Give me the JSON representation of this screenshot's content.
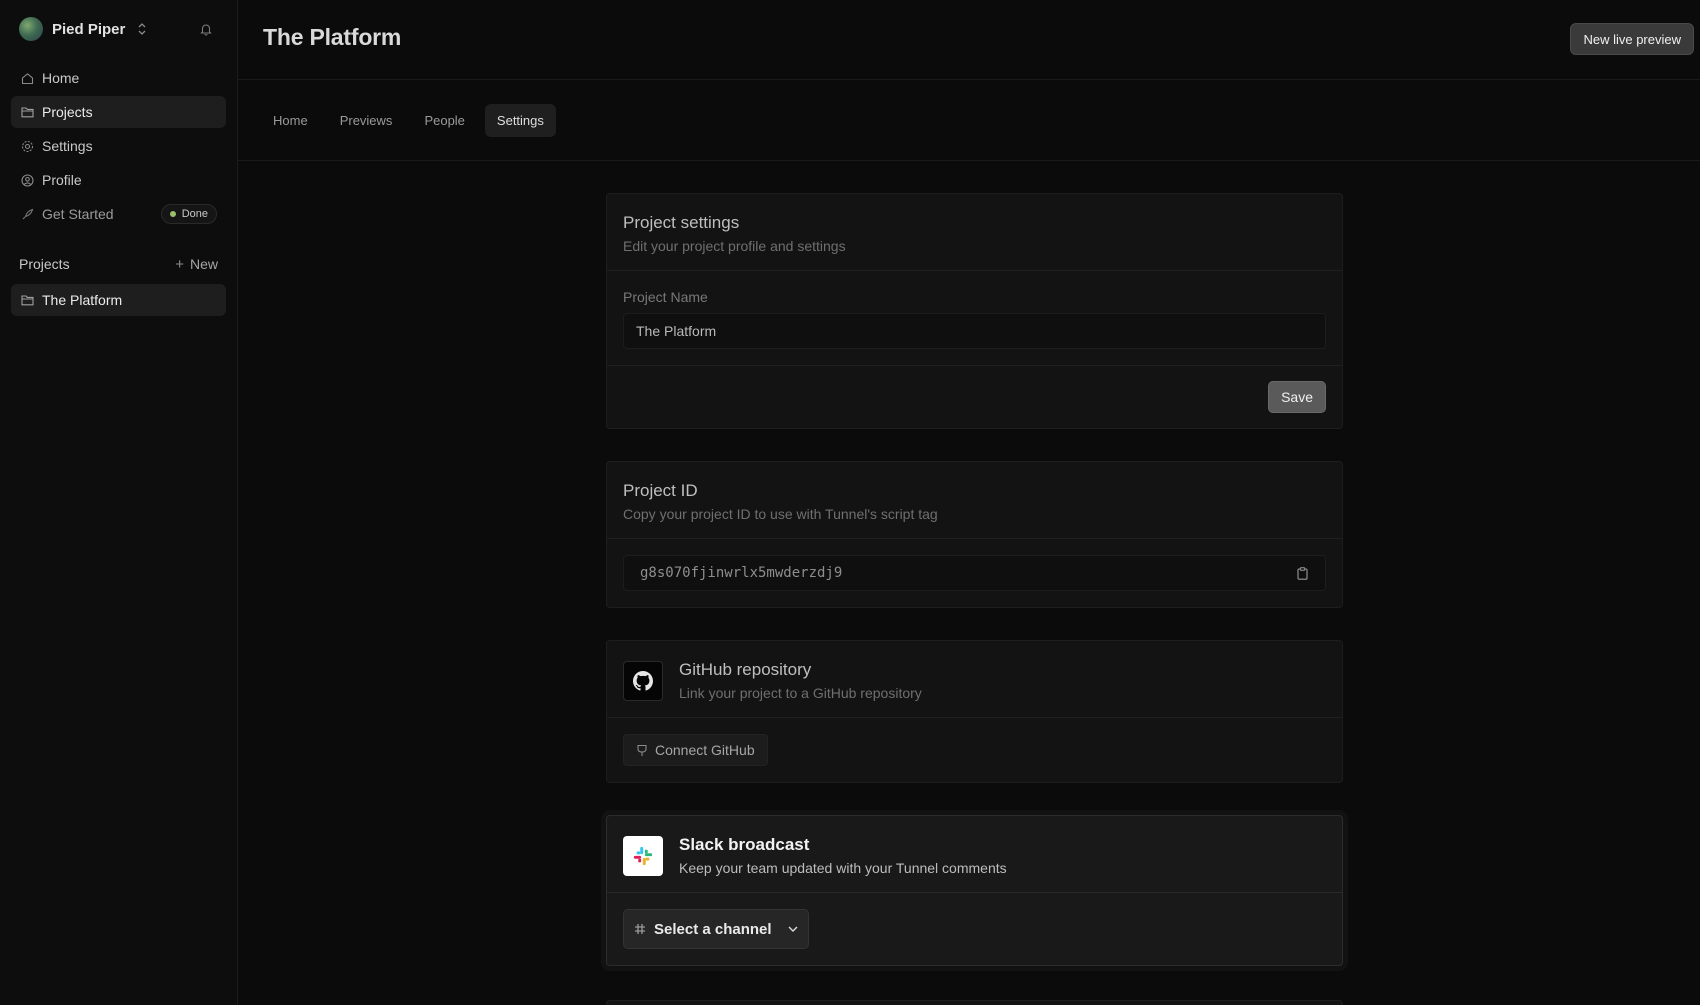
{
  "org": {
    "name": "Pied Piper",
    "avatar_icon": "org-avatar",
    "switch_icon": "chevrons-up-down-icon",
    "bell_icon": "bell-icon"
  },
  "nav": {
    "home": "Home",
    "projects": "Projects",
    "settings": "Settings",
    "profile": "Profile",
    "get_started": "Get Started",
    "done_badge": "Done"
  },
  "projects_section": {
    "title": "Projects",
    "new_label": "New",
    "items": [
      "The Platform"
    ]
  },
  "page": {
    "title": "The Platform",
    "new_preview_label": "New live preview"
  },
  "tabs": [
    "Home",
    "Previews",
    "People",
    "Settings"
  ],
  "active_tab": "Settings",
  "project_settings": {
    "title": "Project settings",
    "subtitle": "Edit your project profile and settings",
    "name_label": "Project Name",
    "name_value": "The Platform",
    "save_label": "Save"
  },
  "project_id": {
    "title": "Project ID",
    "subtitle": "Copy your project ID to use with Tunnel's script tag",
    "value": "g8s070fjinwrlx5mwderzdj9"
  },
  "github": {
    "title": "GitHub repository",
    "subtitle": "Link your project to a GitHub repository",
    "connect_label": "Connect GitHub"
  },
  "slack": {
    "title": "Slack broadcast",
    "subtitle": "Keep your team updated with your Tunnel comments",
    "select_label": "Select a channel"
  },
  "colors": {
    "background": "#0b0b0b",
    "done_dot": "#9bc06a",
    "primary_button": "#3a3a3a"
  }
}
